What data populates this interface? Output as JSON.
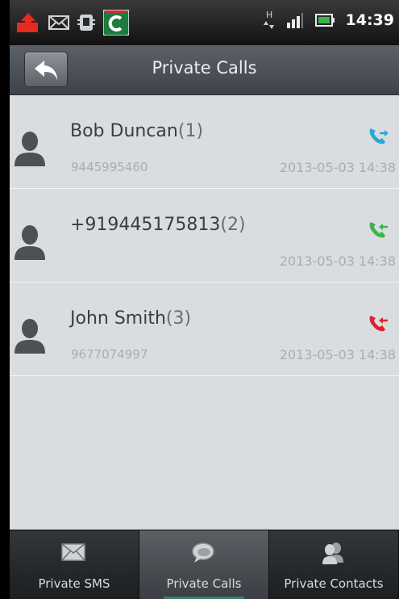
{
  "status_bar": {
    "time": "14:39",
    "network_label": "H",
    "icons": [
      "upload-icon",
      "mail-icon",
      "sd-card-icon",
      "comodo-app-icon",
      "data-arrows-icon",
      "signal-icon",
      "battery-icon"
    ]
  },
  "header": {
    "back_icon": "back-arrow-icon",
    "title": "Private Calls"
  },
  "calls": [
    {
      "name": "Bob Duncan",
      "count": "(1)",
      "number": "9445995460",
      "datetime": "2013-05-03 14:38",
      "type": "outgoing",
      "color": "#2ba7d8"
    },
    {
      "name": "+919445175813",
      "count": "(2)",
      "number": "",
      "datetime": "2013-05-03 14:38",
      "type": "incoming",
      "color": "#39b54a"
    },
    {
      "name": "John Smith",
      "count": "(3)",
      "number": "9677074997",
      "datetime": "2013-05-03 14:38",
      "type": "missed",
      "color": "#d9262c"
    }
  ],
  "tabs": [
    {
      "label": "Private SMS",
      "icon": "envelope-icon",
      "active": false
    },
    {
      "label": "Private Calls",
      "icon": "chat-bubble-icon",
      "active": true
    },
    {
      "label": "Private Contacts",
      "icon": "contacts-icon",
      "active": false
    }
  ]
}
